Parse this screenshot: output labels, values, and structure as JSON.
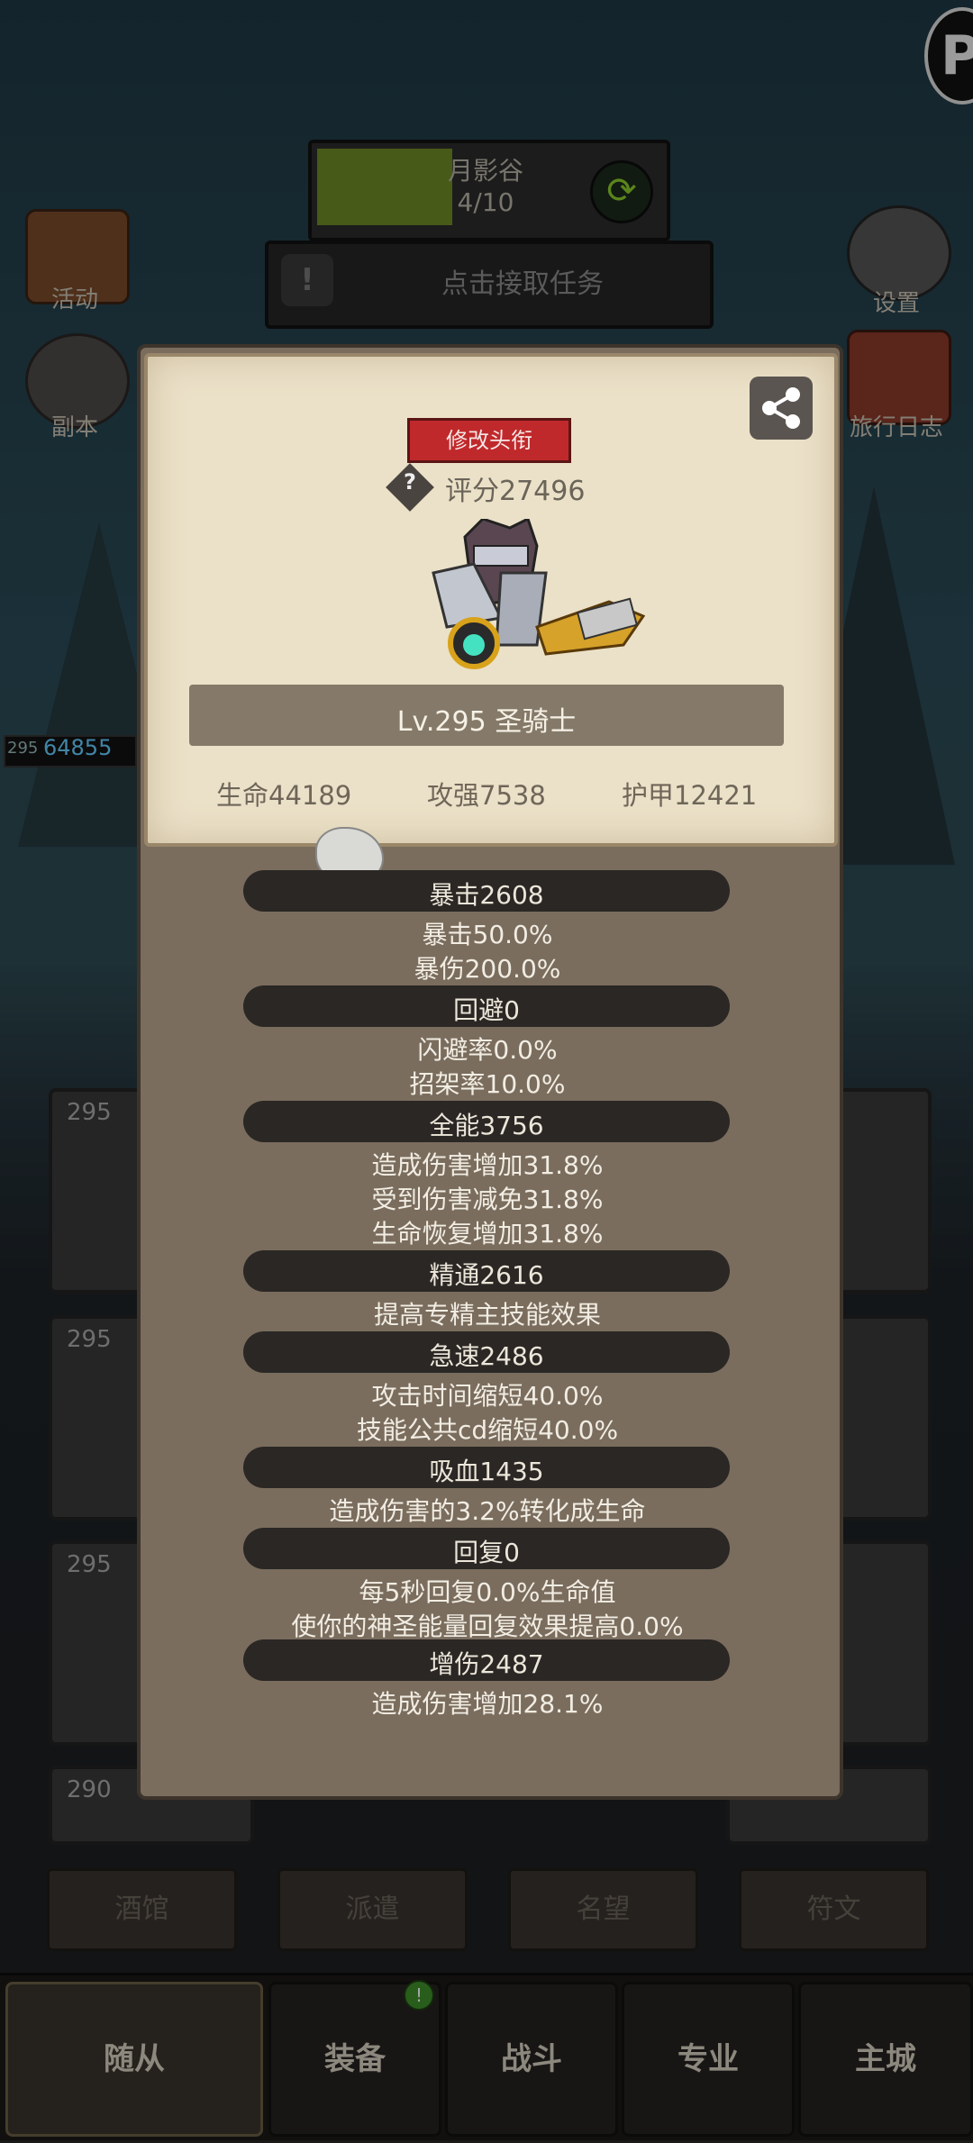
{
  "hud": {
    "zone_name": "月影谷",
    "zone_progress": "4/10",
    "task_text": "点击接取任务",
    "left_icons": [
      {
        "label": "活动"
      },
      {
        "label": "副本"
      }
    ],
    "right_icons": [
      {
        "label": "设置"
      },
      {
        "label": "旅行日志"
      }
    ],
    "hp_bar_level": "295",
    "hp_bar_value": "64855"
  },
  "popup": {
    "title_button": "修改头衔",
    "score": "评分27496",
    "name_line": "Lv.295 圣骑士",
    "stats": {
      "hp": "生命44189",
      "atk": "攻强7538",
      "armor": "护甲12421"
    },
    "sections": [
      {
        "header": "暴击2608",
        "lines": [
          "暴击50.0%",
          "暴伤200.0%"
        ]
      },
      {
        "header": "回避0",
        "lines": [
          "闪避率0.0%",
          "招架率10.0%"
        ]
      },
      {
        "header": "全能3756",
        "lines": [
          "造成伤害增加31.8%",
          "受到伤害减免31.8%",
          "生命恢复增加31.8%"
        ]
      },
      {
        "header": "精通2616",
        "lines": [
          "提高专精主技能效果"
        ]
      },
      {
        "header": "急速2486",
        "lines": [
          "攻击时间缩短40.0%",
          "技能公共cd缩短40.0%"
        ]
      },
      {
        "header": "吸血1435",
        "lines": [
          "造成伤害的3.2%转化成生命"
        ]
      },
      {
        "header": "回复0",
        "lines": [
          "每5秒回复0.0%生命值",
          "使你的神圣能量回复效果提高0.0%"
        ]
      },
      {
        "header": "增伤2487",
        "lines": [
          "造成伤害增加28.1%"
        ]
      }
    ]
  },
  "cards": {
    "levels": [
      "295",
      "295",
      "295",
      "290"
    ]
  },
  "sub_tabs": [
    "酒馆",
    "派遣",
    "名望",
    "符文"
  ],
  "bottom_nav": [
    "随从",
    "装备",
    "战斗",
    "专业",
    "主城"
  ],
  "colors": {
    "accent_red": "#c0292b",
    "zone_green": "#6d8a26",
    "parchment": "#ebe1c8"
  }
}
